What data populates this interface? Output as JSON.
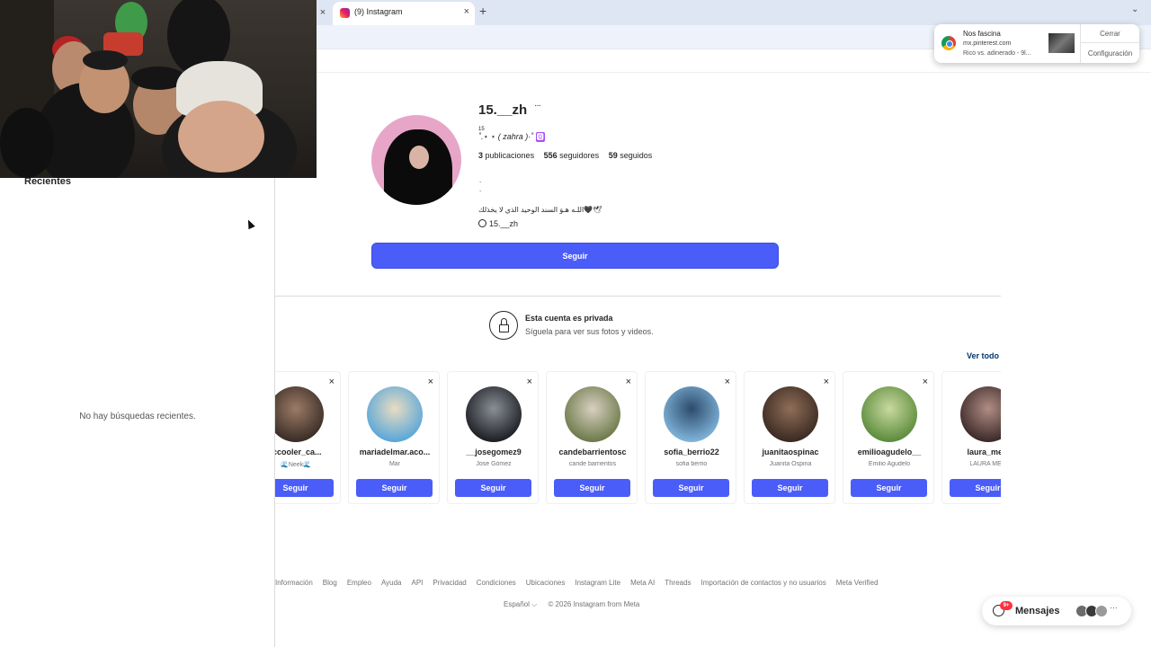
{
  "browser": {
    "tab_title": "(9) Instagram",
    "new_tab": "+",
    "close_glyph": "×",
    "menu_glyph": "⌄"
  },
  "notification": {
    "title": "Nos fascina",
    "site": "mx.pinterest.com",
    "body": "Rico vs. adinerado - 9l...",
    "close_label": "Cerrar",
    "settings_label": "Configuración"
  },
  "search_panel": {
    "title": "Recientes",
    "empty_text": "No hay búsquedas recientes."
  },
  "profile": {
    "username": "15.__zh",
    "more": "···",
    "fullname": "15",
    "bio_line": "˚.⋆ ⋆ ( zahra )·˚",
    "bio_emoji": "🆀",
    "stats": {
      "posts_value": "3",
      "posts_label": "publicaciones",
      "followers_value": "556",
      "followers_label": "seguidores",
      "following_value": "59",
      "following_label": "seguidos"
    },
    "bio_dot_1": ".",
    "bio_dot_2": ".",
    "bio_arabic": "اللـه هـوَ السند الوحيد الذي لا يخذلك🖤🕊",
    "threads_handle": "15.__zh",
    "follow_label": "Seguir"
  },
  "private": {
    "title": "Esta cuenta es privada",
    "subtitle": "Síguela para ver sus fotos y videos.",
    "see_all": "Ver todo"
  },
  "suggestions": [
    {
      "username": "iccooler_ca...",
      "name": "🌊Neek🌊",
      "button": "Seguir",
      "colors": [
        "#3a2d26",
        "#9c7b66"
      ]
    },
    {
      "username": "mariadelmar.aco...",
      "name": "Mar",
      "button": "Seguir",
      "colors": [
        "#5aa7d8",
        "#e9dcc2"
      ]
    },
    {
      "username": "__josegomez9",
      "name": "Jose Gómez",
      "button": "Seguir",
      "colors": [
        "#1d1f24",
        "#8a8f96"
      ]
    },
    {
      "username": "candebarrientosc",
      "name": "cande barrientos",
      "button": "Seguir",
      "colors": [
        "#6d7a4b",
        "#d8d0c0"
      ]
    },
    {
      "username": "sofia_berrio22",
      "name": "sofia berrio",
      "button": "Seguir",
      "colors": [
        "#7fb3d9",
        "#2d4c6b"
      ]
    },
    {
      "username": "juanitaospinac",
      "name": "Juanita Ospina",
      "button": "Seguir",
      "colors": [
        "#3b2a22",
        "#8f6e58"
      ]
    },
    {
      "username": "emilioagudelo__",
      "name": "Emilio Agudelo",
      "button": "Seguir",
      "colors": [
        "#5c8c3c",
        "#c9d9a0"
      ]
    },
    {
      "username": "laura_mejii",
      "name": "LAURA ME...",
      "button": "Seguir",
      "colors": [
        "#3d2a2a",
        "#b08d84"
      ]
    }
  ],
  "footer": {
    "links": [
      "Información",
      "Blog",
      "Empleo",
      "Ayuda",
      "API",
      "Privacidad",
      "Condiciones",
      "Ubicaciones",
      "Instagram Lite",
      "Meta AI",
      "Threads",
      "Importación de contactos y no usuarios",
      "Meta Verified"
    ],
    "language": "Español ⌵",
    "copyright": "© 2026 Instagram from Meta"
  },
  "messages": {
    "label": "Mensajes",
    "badge": "9+",
    "more": "···"
  },
  "colors": {
    "accent": "#4a5df9",
    "link": "#00376b",
    "badge": "#ff3040"
  }
}
